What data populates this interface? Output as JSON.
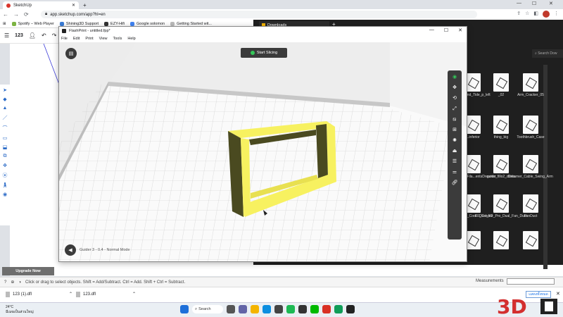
{
  "browser": {
    "tab_title": "SketchUp",
    "url": "app.sketchup.com/app?hl=en",
    "bookmarks": [
      "Spotify – Web Player",
      "Shining3D Support",
      "EZY-Hifi",
      "Google solomon",
      "Getting Started wit..."
    ]
  },
  "sketchup": {
    "counter": "123",
    "upgrade_label": "Upgrade Now",
    "status_text": "Click or drag to select objects. Shift = Add/Subtract. Ctrl = Add. Shift + Ctrl = Subtract.",
    "measurements_label": "Measurements",
    "downloads": [
      "123 (1).dfl",
      "123.dfl"
    ],
    "show_all_label": "แสดงทั้งหมด"
  },
  "explorer": {
    "tab_title": "Downloads",
    "search_placeholder": "Search Dow",
    "files": [
      {
        "name": "...p_stand_Tide_p_left"
      },
      {
        "name": "_02"
      },
      {
        "name": "Arm_Cracker_05"
      },
      {
        "name": "...inferior"
      },
      {
        "name": "thing_big"
      },
      {
        "name": "Toothbrush_Case"
      },
      {
        "name": "...bleGuideFila...entsDreamer"
      },
      {
        "name": "guide_fillo2_droits"
      },
      {
        "name": "Dreamer_Cable_Swing_Arm"
      },
      {
        "name": "..._Forge_Cool...Duct_V2"
      },
      {
        "name": "FF_Creator_Pro_Dual_Fan_Duct"
      },
      {
        "name": "FanDuct"
      },
      {
        "name": ""
      },
      {
        "name": ""
      },
      {
        "name": ""
      }
    ]
  },
  "flashprint": {
    "title": "FlashPrint - untitled.fpp*",
    "menu": [
      "File",
      "Edit",
      "Print",
      "View",
      "Tools",
      "Help"
    ],
    "slice_label": "Start Slicing",
    "machine_status": "Guider 3 - 0.4 - Normal Mode",
    "model_color": "#f7f160"
  },
  "taskbar": {
    "temperature": "24°C",
    "weather": "มีเมฆเป็นส่วนใหญ่",
    "search_label": "Search"
  },
  "watermark_text": "3D"
}
